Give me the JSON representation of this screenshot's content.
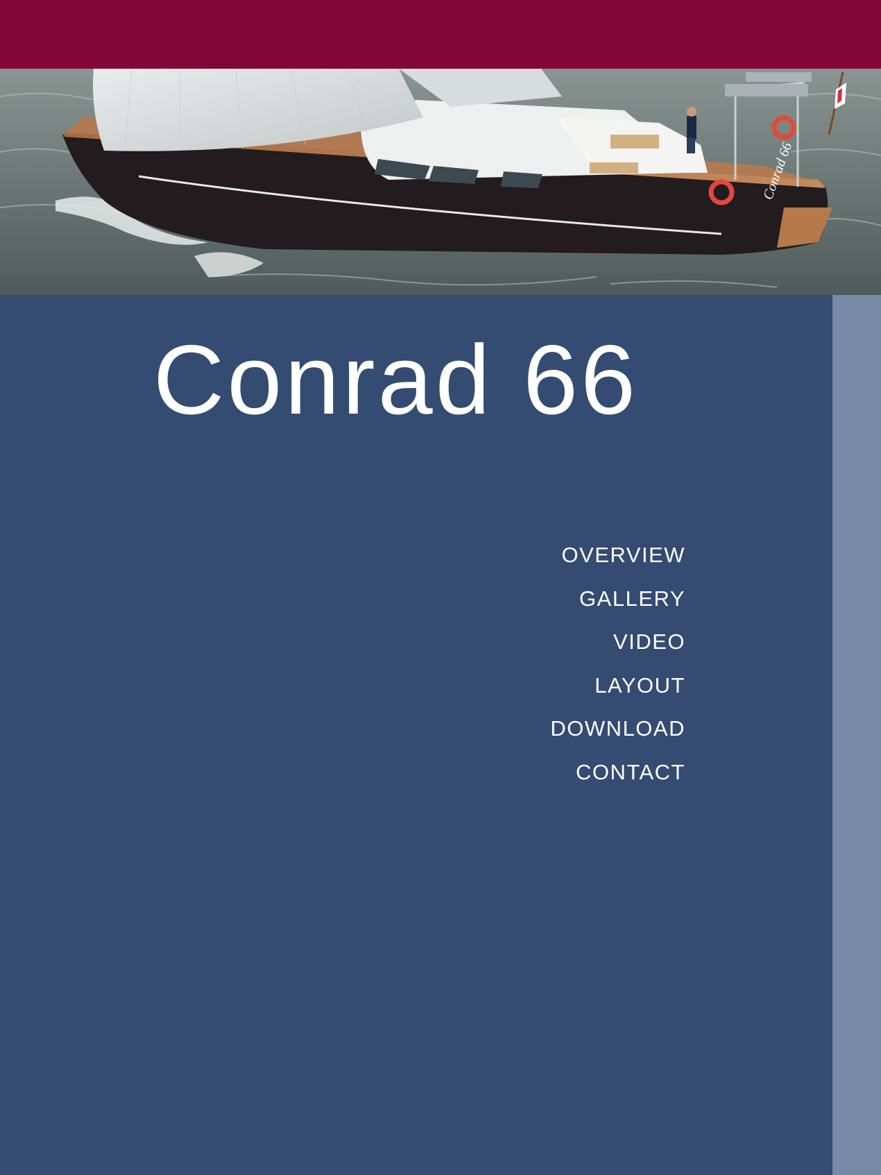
{
  "colors": {
    "top_bar": "#830838",
    "main_panel": "#344b72",
    "side_strip": "#7889a6",
    "text": "#ffffff"
  },
  "hero": {
    "image": "sailing-yacht-photo-icon",
    "hull_lettering": "Conrad 66"
  },
  "title": "Conrad 66",
  "nav": {
    "items": [
      {
        "label": "OVERVIEW"
      },
      {
        "label": "GALLERY"
      },
      {
        "label": "VIDEO"
      },
      {
        "label": "LAYOUT"
      },
      {
        "label": "DOWNLOAD"
      },
      {
        "label": "CONTACT"
      }
    ]
  }
}
